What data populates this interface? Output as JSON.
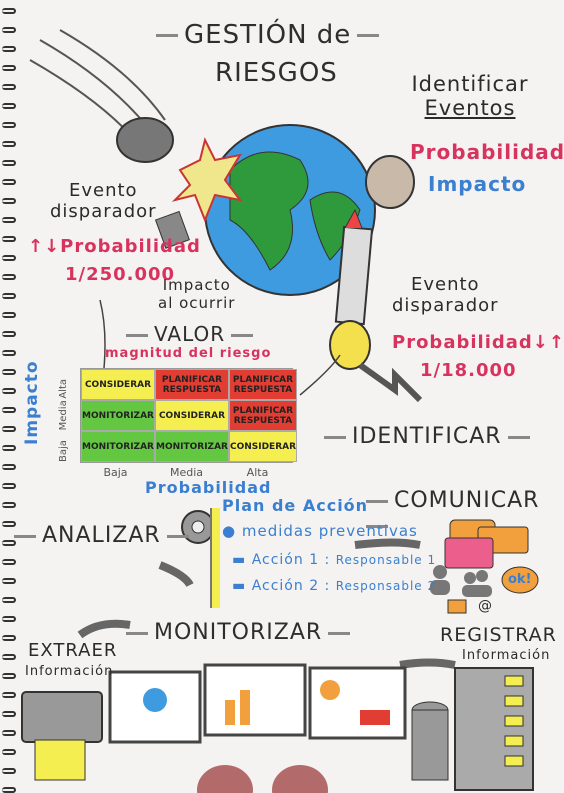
{
  "title": {
    "line1": "GESTIÓN de",
    "line2": "RIESGOS"
  },
  "identify_events": {
    "line1": "Identificar",
    "line2": "Eventos",
    "prob": "Probabilidad",
    "impact": "Impacto"
  },
  "trigger_left": {
    "line1": "Evento",
    "line2": "disparador",
    "prob": "↑↓Probabilidad",
    "value": "1/250.000"
  },
  "impact_on_occur": {
    "line1": "Impacto",
    "line2": "al ocurrir"
  },
  "trigger_right": {
    "line1": "Evento",
    "line2": "disparador",
    "prob": "Probabilidad↓↑",
    "value": "1/18.000"
  },
  "valor": {
    "title": "VALOR",
    "subtitle": "magnitud del riesgo"
  },
  "matrix": {
    "y_axis": "Impacto",
    "y_ticks": [
      "Alta",
      "Media",
      "Baja"
    ],
    "x_axis": "Probabilidad",
    "x_ticks": [
      "Baja",
      "Media",
      "Alta"
    ],
    "rows": [
      [
        {
          "t": "CONSIDERAR",
          "c": "y"
        },
        {
          "t": "PLANIFICAR RESPUESTA",
          "c": "r"
        },
        {
          "t": "PLANIFICAR RESPUESTA",
          "c": "r"
        }
      ],
      [
        {
          "t": "MONITORIZAR",
          "c": "g"
        },
        {
          "t": "CONSIDERAR",
          "c": "y"
        },
        {
          "t": "PLANIFICAR RESPUESTA",
          "c": "r"
        }
      ],
      [
        {
          "t": "MONITORIZAR",
          "c": "g"
        },
        {
          "t": "MONITORIZAR",
          "c": "g"
        },
        {
          "t": "CONSIDERAR",
          "c": "y"
        }
      ]
    ]
  },
  "steps": {
    "identificar": "IDENTIFICAR",
    "analizar": "ANALIZAR",
    "comunicar": "COMUNICAR",
    "monitorizar": "MONITORIZAR",
    "registrar": "REGISTRAR",
    "registrar_sub": "Información",
    "extraer": "EXTRAER",
    "extraer_sub": "Información"
  },
  "plan": {
    "title": "Plan de Acción",
    "measures": "medidas preventivas",
    "actions": [
      {
        "a": "Acción 1",
        "r": "Responsable 1"
      },
      {
        "a": "Acción 2",
        "r": "Responsable 2"
      }
    ]
  },
  "ok": "ok!",
  "at": "@",
  "colors": {
    "pink": "#d8335e",
    "blue": "#3a7fd0",
    "yellow": "#f5ee50",
    "green": "#63c742",
    "red": "#e23d33"
  }
}
